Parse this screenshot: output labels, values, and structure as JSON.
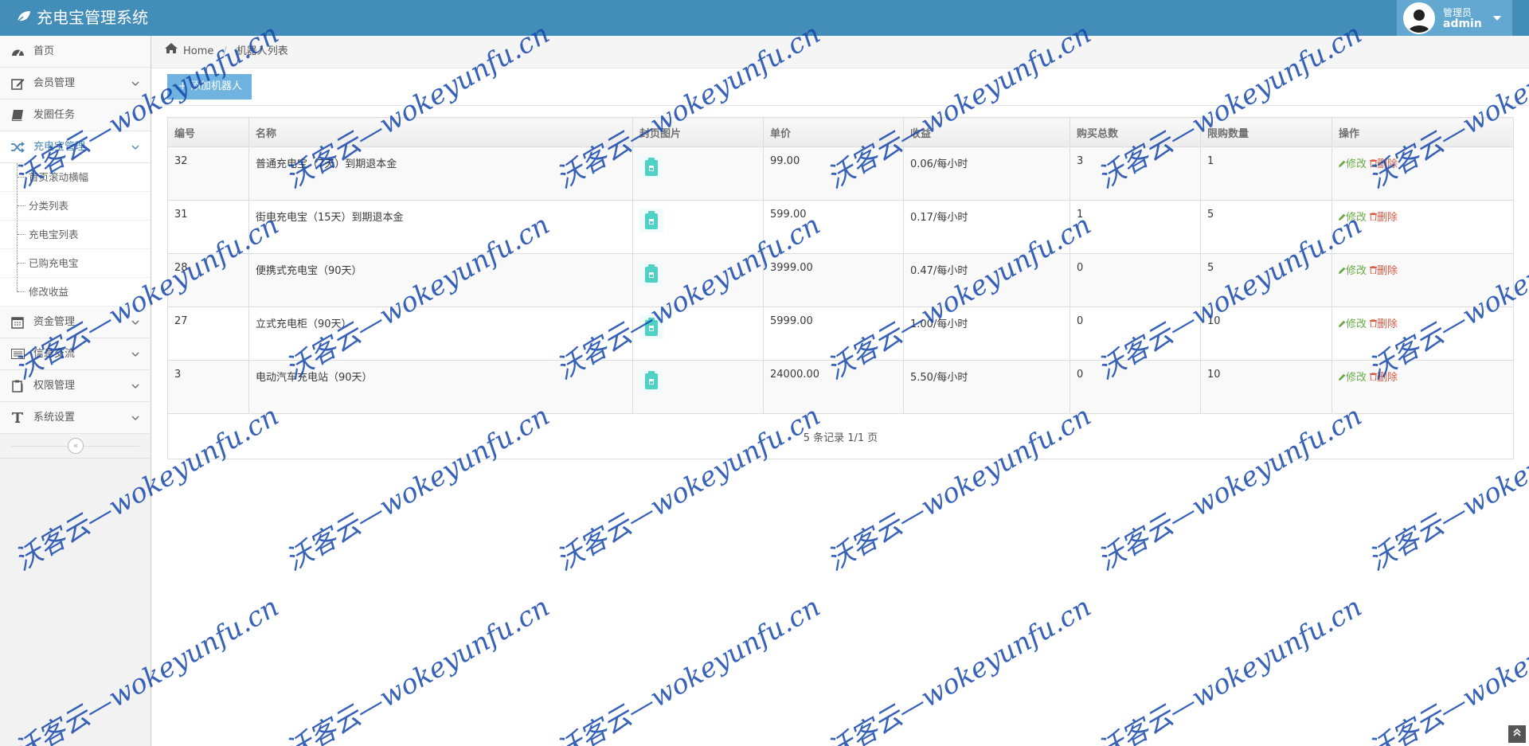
{
  "app": {
    "title": "充电宝管理系统"
  },
  "user": {
    "role": "管理员",
    "name": "admin"
  },
  "sidebar": {
    "items": [
      {
        "label": "首页",
        "icon": "tachometer-icon",
        "has_children": false
      },
      {
        "label": "会员管理",
        "icon": "edit-icon",
        "has_children": true
      },
      {
        "label": "发圈任务",
        "icon": "book-icon",
        "has_children": false
      },
      {
        "label": "充电宝管理",
        "icon": "random-icon",
        "has_children": true,
        "open": true
      },
      {
        "label": "资金管理",
        "icon": "calendar-icon",
        "has_children": true
      },
      {
        "label": "信息交流",
        "icon": "list-icon",
        "has_children": true
      },
      {
        "label": "权限管理",
        "icon": "clipboard-icon",
        "has_children": true
      },
      {
        "label": "系统设置",
        "icon": "text-icon",
        "has_children": true
      }
    ],
    "subitems": [
      "首页滚动横幅",
      "分类列表",
      "充电宝列表",
      "已购充电宝",
      "修改收益"
    ],
    "collapse_label": "«"
  },
  "breadcrumb": {
    "home": "Home",
    "current": "机器人列表"
  },
  "toolbar": {
    "add_label": "+ 添加机器人"
  },
  "table": {
    "columns": [
      "编号",
      "名称",
      "封页图片",
      "单价",
      "收益",
      "购买总数",
      "限购数量",
      "操作"
    ],
    "rows": [
      {
        "id": "32",
        "name": "普通充电宝（7天）到期退本金",
        "price": "99.00",
        "income": "0.06/每小时",
        "total": "3",
        "limit": "1"
      },
      {
        "id": "31",
        "name": "街电充电宝（15天）到期退本金",
        "price": "599.00",
        "income": "0.17/每小时",
        "total": "1",
        "limit": "5"
      },
      {
        "id": "28",
        "name": "便携式充电宝（90天）",
        "price": "3999.00",
        "income": "0.47/每小时",
        "total": "0",
        "limit": "5"
      },
      {
        "id": "27",
        "name": "立式充电柜（90天）",
        "price": "5999.00",
        "income": "1.00/每小时",
        "total": "0",
        "limit": "10"
      },
      {
        "id": "3",
        "name": "电动汽车充电站（90天）",
        "price": "24000.00",
        "income": "5.50/每小时",
        "total": "0",
        "limit": "10"
      }
    ],
    "edit_label": "修改",
    "delete_label": "删除",
    "footer": "5 条记录 1/1 页"
  },
  "watermark": {
    "text": "沃客云—wokeyunfu.cn"
  },
  "colors": {
    "navbar": "#438eb9",
    "accent": "#4b88b7",
    "edit": "#69aa46",
    "delete": "#dd5a43",
    "cover_icon": "#4fd1c5",
    "button": "#6fb3e0"
  }
}
